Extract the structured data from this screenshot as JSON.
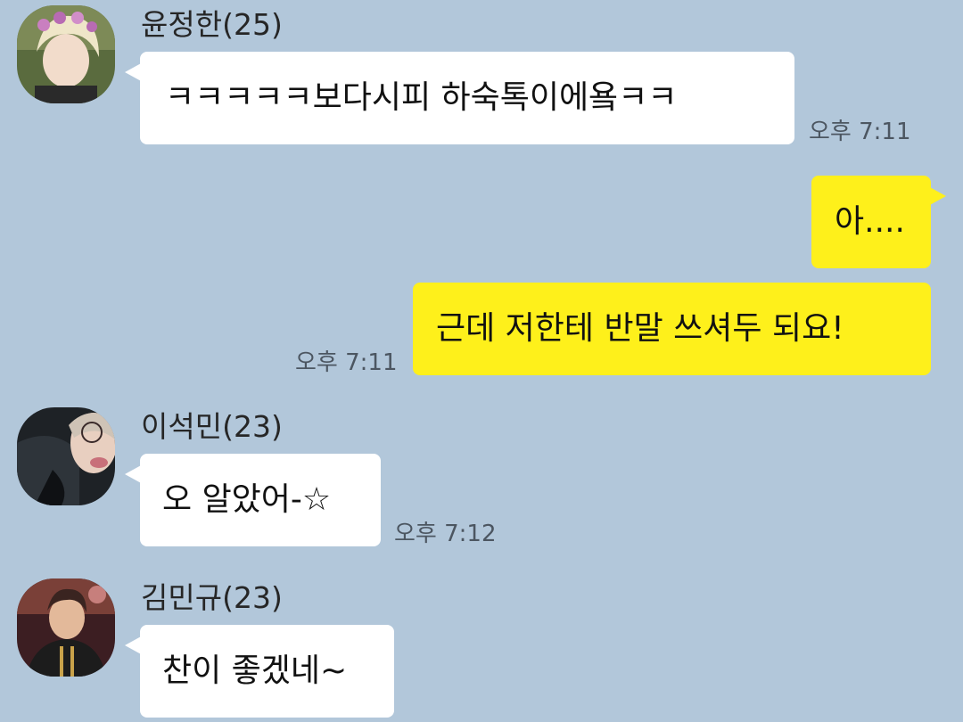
{
  "theme": {
    "background": "#b2c7da",
    "incoming_bubble": "#ffffff",
    "outgoing_bubble": "#fef01b"
  },
  "messages": [
    {
      "direction": "incoming",
      "sender": "윤정한(25)",
      "avatar_icon": "profile-photo-icon",
      "text": "ㅋㅋㅋㅋㅋ보다시피 하숙톡이에욬ㅋㅋ",
      "time": "오후 7:11"
    },
    {
      "direction": "outgoing",
      "text": "아....",
      "time": ""
    },
    {
      "direction": "outgoing",
      "text": "근데 저한테 반말 쓰셔두 되요!",
      "time": "오후 7:11"
    },
    {
      "direction": "incoming",
      "sender": "이석민(23)",
      "avatar_icon": "profile-photo-icon",
      "text": "오 알았어-☆",
      "time": "오후 7:12"
    },
    {
      "direction": "incoming",
      "sender": "김민규(23)",
      "avatar_icon": "profile-photo-icon",
      "text": "찬이 좋겠네~",
      "time": ""
    }
  ]
}
